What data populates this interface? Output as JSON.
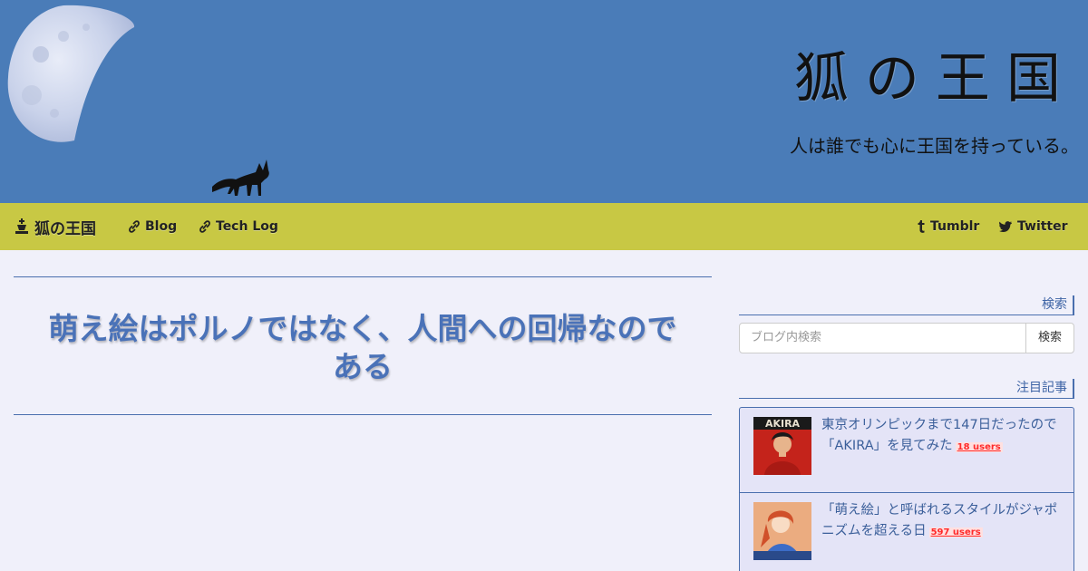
{
  "header": {
    "title": "狐の王国",
    "tagline": "人は誰でも心に王国を持っている。"
  },
  "nav": {
    "home_label": "狐の王国",
    "blog_label": "Blog",
    "tech_label": "Tech Log",
    "tumblr_label": "Tumblr",
    "twitter_label": "Twitter"
  },
  "article": {
    "title": "萌え絵はポルノではなく、人間への回帰なのである"
  },
  "sidebar": {
    "search_heading": "検索",
    "search_placeholder": "ブログ内検索",
    "search_button": "検索",
    "featured_heading": "注目記事",
    "featured": [
      {
        "title": "東京オリンピックまで147日だったので「AKIRA」を見てみた",
        "users": "18 users"
      },
      {
        "title": "「萌え絵」と呼ばれるスタイルがジャポニズムを超える日",
        "users": "597 users"
      }
    ]
  },
  "colors": {
    "header_bg": "#4a7cb8",
    "nav_bg": "#c8c844",
    "accent": "#4a72b8",
    "users_badge": "#ff2a2a"
  },
  "icons": [
    "moon-image",
    "fox-silhouette-icon",
    "chess-king-icon",
    "link-icon",
    "tumblr-icon",
    "twitter-icon"
  ]
}
